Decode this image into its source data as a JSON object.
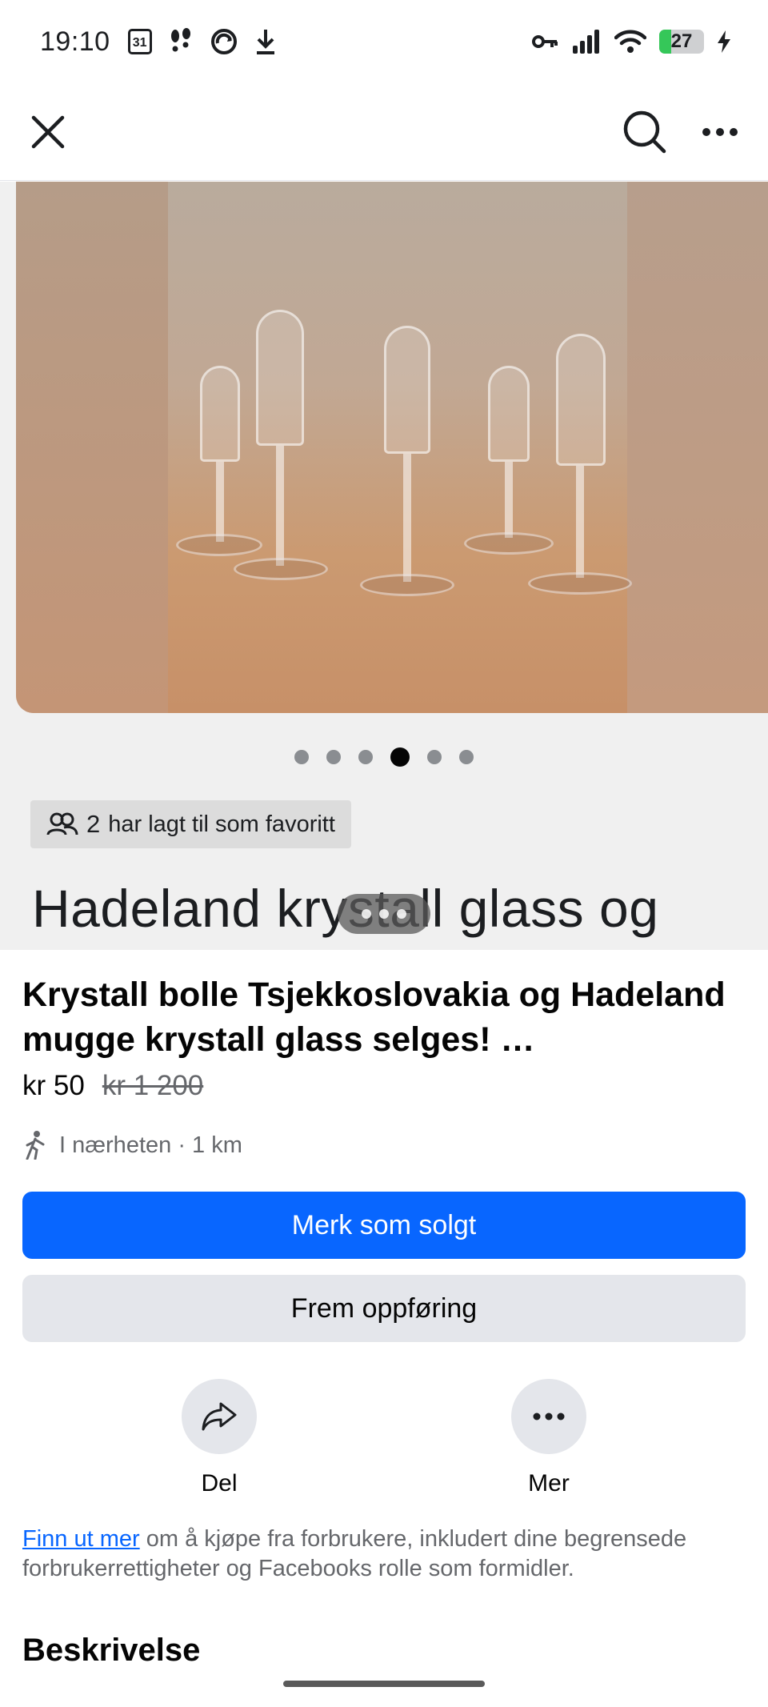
{
  "status_bar": {
    "time": "19:10",
    "calendar_day": "31",
    "battery_level": "27",
    "icons": [
      "calendar-icon",
      "footsteps-icon",
      "cloud-sync-icon",
      "download-icon",
      "vpn-key-icon",
      "signal-icon",
      "wifi-icon",
      "battery-icon",
      "charging-icon"
    ]
  },
  "top_nav": {
    "icons": [
      "close-icon",
      "search-icon",
      "more-icon"
    ]
  },
  "media": {
    "image_count": 6,
    "active_image_index": 3,
    "favorites": {
      "count": "2",
      "label": "har lagt til som favoritt"
    },
    "overlay_title": "Hadeland krystall glass og"
  },
  "listing": {
    "title": "Krystall bolle Tsjekkoslovakia og Hadeland  mugge krystall glass selges! …",
    "price": "kr 50",
    "original_price": "kr 1 200",
    "location": "I nærheten · 1 km"
  },
  "buttons": {
    "mark_sold": "Merk som solgt",
    "promote": "Frem oppføring"
  },
  "actions": [
    {
      "label": "Del",
      "icon": "share-icon"
    },
    {
      "label": "Mer",
      "icon": "more-icon"
    }
  ],
  "info": {
    "link_text": "Finn ut mer",
    "text": " om å kjøpe fra forbrukere, inkludert dine begrensede forbrukerrettigheter og Facebooks rolle som formidler."
  },
  "description": {
    "heading": "Beskrivelse"
  },
  "colors": {
    "primary": "#0866ff",
    "secondary_button": "#e4e6eb",
    "text_primary": "#050505",
    "text_secondary": "#65676b",
    "battery_fill": "#35c759"
  }
}
